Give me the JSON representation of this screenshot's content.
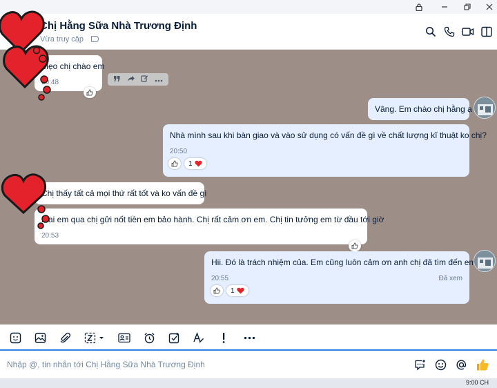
{
  "window": {
    "controls": [
      "lock-icon",
      "minimize-icon",
      "restore-icon",
      "close-icon"
    ]
  },
  "header": {
    "contact_name": "Chị Hằng Sữa Nhà Trương Định",
    "status": "Vừa truy cập",
    "actions": [
      "search-icon",
      "phone-icon",
      "video-call-icon",
      "layout-toggle-icon"
    ]
  },
  "messages": [
    {
      "id": 1,
      "direction": "in",
      "text": "Mẹo chị chào em",
      "time": "20:48",
      "reaction": "like-icon"
    },
    {
      "id": 2,
      "direction": "out",
      "text": "Vâng. Em chào chị hằng ạ"
    },
    {
      "id": 3,
      "direction": "out",
      "text": "Nhà mình sau khi bàn giao và vào sử dụng có vấn đề gì về chất lượng kĩ thuật ko chị?",
      "time": "20:50",
      "reaction_count": "1"
    },
    {
      "id": 4,
      "direction": "in",
      "text": "Chị thấy tất cả mọi thứ rất tốt  và ko vấn đề gì"
    },
    {
      "id": 5,
      "direction": "in",
      "text": "Mai em qua chị gửi nốt tiền em bảo hành. Chị rất cảm ơn em. Chị tin tưởng em từ đầu tới giờ",
      "time": "20:53"
    },
    {
      "id": 6,
      "direction": "out",
      "text": "Hii. Đó là trách nhiệm của.  Em cũng luôn cảm ơn anh chị đã tìm đến em.",
      "time": "20:55",
      "seen": "Đã xem",
      "reaction_count": "1"
    }
  ],
  "hover_actions": [
    "quote-icon",
    "forward-icon",
    "edit-icon",
    "more-icon"
  ],
  "toolbar": [
    "sticker-icon",
    "image-icon",
    "attachment-icon",
    "screenshot-icon",
    "contact-card-icon",
    "reminder-icon",
    "task-icon",
    "format-icon",
    "urgent-icon",
    "more-icon"
  ],
  "composer": {
    "placeholder": "Nhập @, tin nhắn tới Chị Hằng Sữa Nhà Trương Định",
    "actions": [
      "quick-message-icon",
      "emoji-icon",
      "mention-icon",
      "like-icon"
    ]
  },
  "taskbar": {
    "clock": "9:00 CH"
  },
  "colors": {
    "accent": "#2f80ed",
    "chat_background": "#9d8f88",
    "outgoing_bubble": "#e5efff",
    "incoming_bubble": "#ffffff",
    "heart": "#e3222b",
    "like_button": "#f5b92a"
  }
}
